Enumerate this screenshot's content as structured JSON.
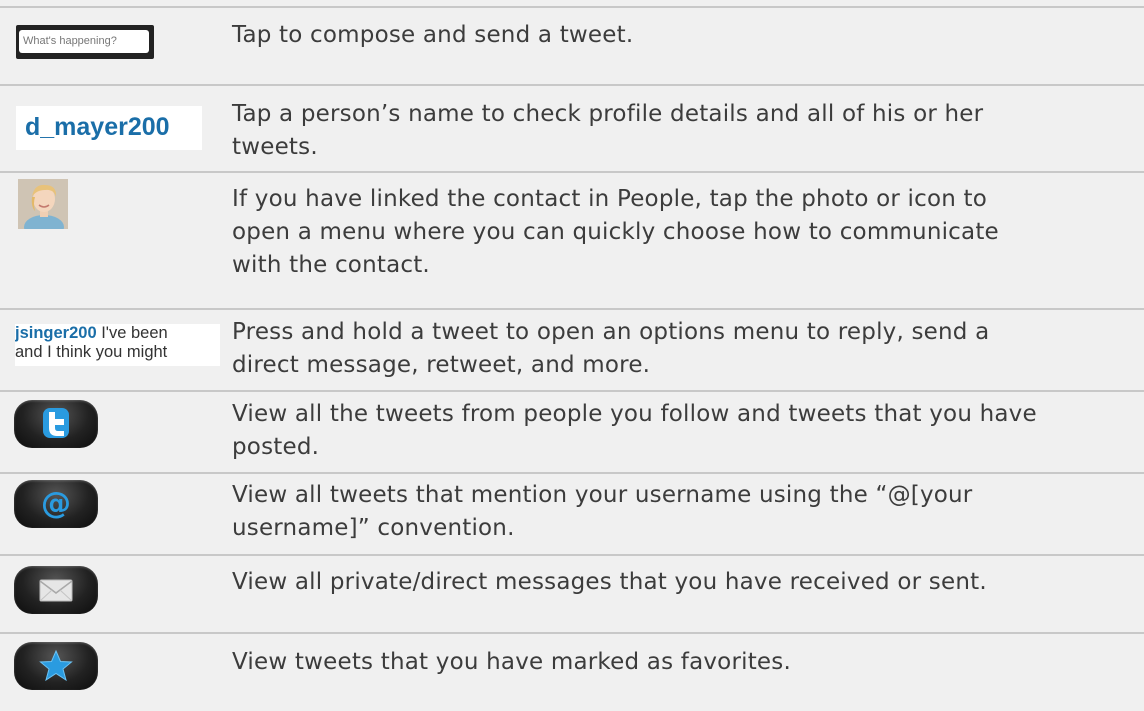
{
  "rows": [
    {
      "icon": "compose-box",
      "icon_text": "What's happening?",
      "description": [
        "Tap to compose and send a tweet."
      ]
    },
    {
      "icon": "username",
      "icon_text": "d_mayer200",
      "description": [
        "Tap a person’s name to check profile details and all of his or her",
        "tweets."
      ]
    },
    {
      "icon": "contact-photo",
      "description": [
        "If you have linked the contact in People, tap the photo or icon to",
        "open a menu where you can quickly choose how to communicate",
        "with the contact."
      ]
    },
    {
      "icon": "tweet-snippet",
      "icon_user": "jsinger200",
      "icon_text_1": " I've been",
      "icon_text_2": "and I think you might",
      "description": [
        "Press and hold a tweet to open an options menu to reply, send a",
        "direct message, retweet, and more."
      ]
    },
    {
      "icon": "twitter-bird-icon",
      "description": [
        "View all the tweets from people you follow and tweets that you have",
        "posted."
      ]
    },
    {
      "icon": "at-sign-icon",
      "description": [
        "View all tweets that mention your username using the “@[your",
        "username]” convention."
      ]
    },
    {
      "icon": "envelope-icon",
      "description": [
        "View all private/direct messages that you have received or sent."
      ]
    },
    {
      "icon": "star-icon",
      "description": [
        "View tweets that you have marked as favorites."
      ]
    }
  ],
  "colors": {
    "username": "#1a6ea8",
    "tab_blue": "#2a9be0",
    "row_bg": "#f0f0f0",
    "divider": "#c8c8c8"
  }
}
